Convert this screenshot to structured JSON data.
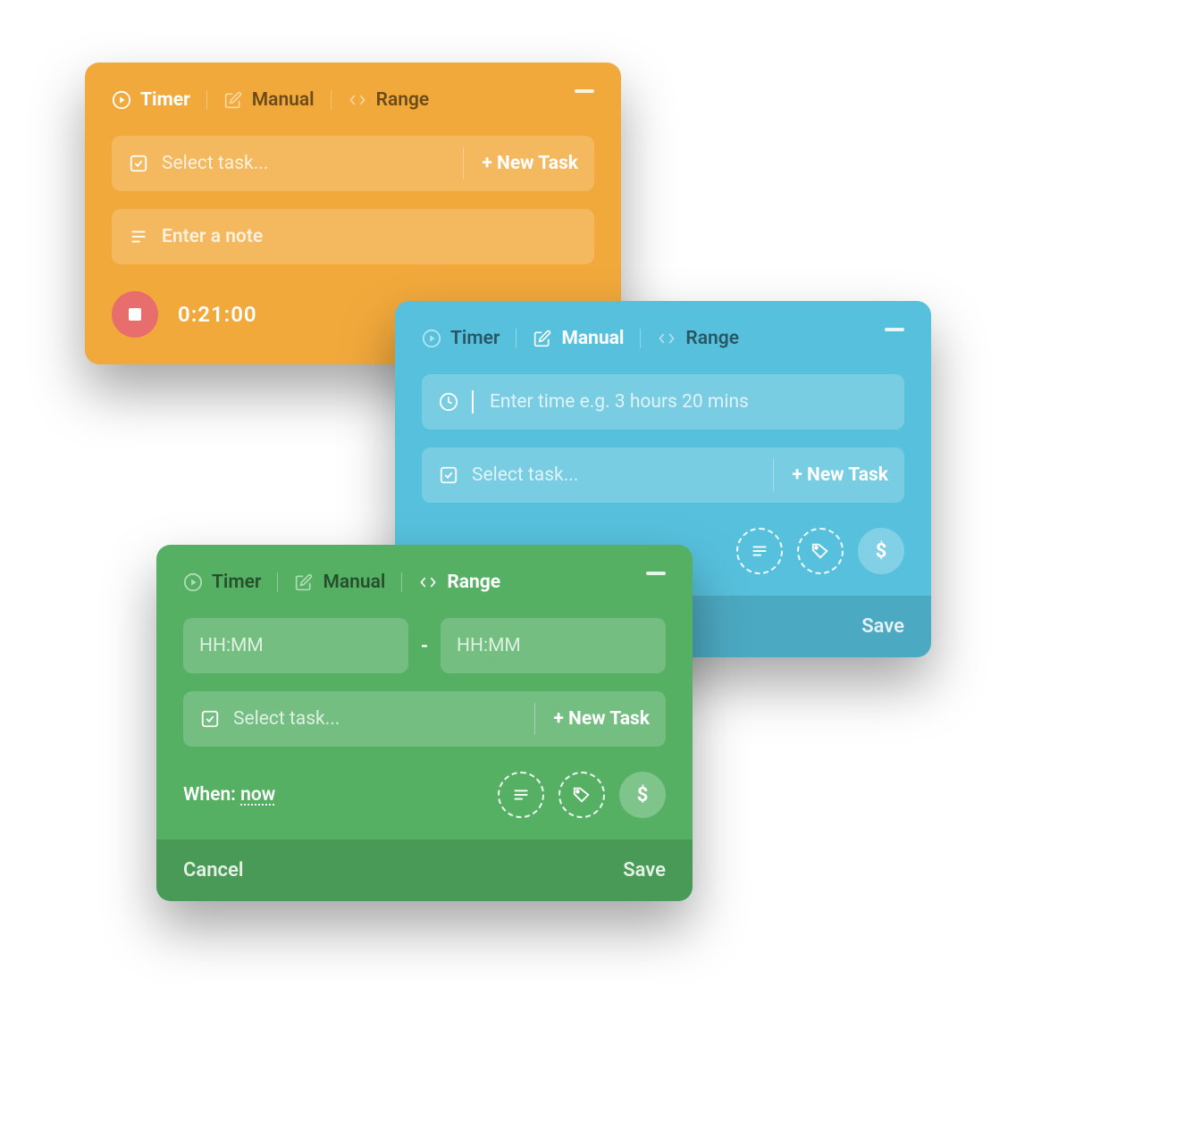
{
  "tabs": {
    "timer": "Timer",
    "manual": "Manual",
    "range": "Range"
  },
  "common": {
    "select_task_placeholder": "Select task...",
    "new_task_label": "+ New Task",
    "cancel_label": "Cancel",
    "save_label": "Save"
  },
  "orange": {
    "note_placeholder": "Enter a note",
    "timer_value": "0:21:00"
  },
  "blue": {
    "time_placeholder": "Enter time e.g. 3 hours 20 mins"
  },
  "green": {
    "start_placeholder": "HH:MM",
    "end_placeholder": "HH:MM",
    "range_dash": "-",
    "when_label": "When:",
    "when_value": "now",
    "dollar": "$"
  },
  "icons": {
    "dollar": "$"
  }
}
